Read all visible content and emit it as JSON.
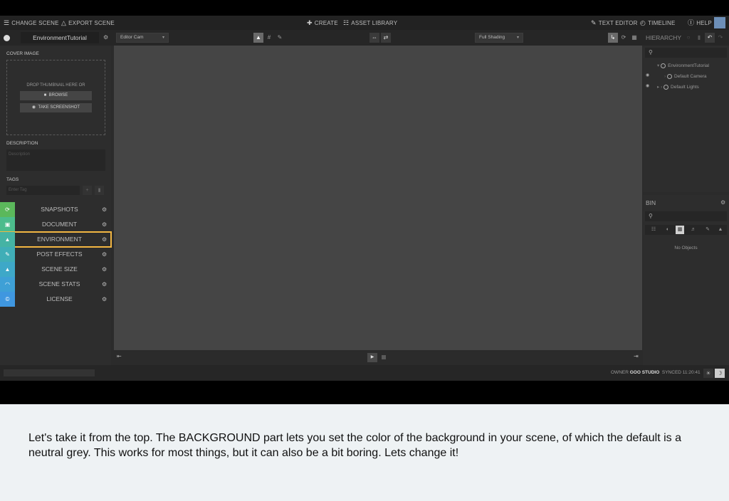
{
  "menubar": {
    "change_scene": "CHANGE SCENE",
    "export_scene": "EXPORT SCENE",
    "create": "CREATE",
    "asset_library": "ASSET LIBRARY",
    "text_editor": "TEXT EDITOR",
    "timeline": "TIMELINE",
    "help": "HELP"
  },
  "toolbar": {
    "scene_name": "EnvironmentTutorial",
    "camera_select": "Editor Cam",
    "shading_select": "Full Shading",
    "hierarchy_label": "HIERARCHY"
  },
  "left_panel": {
    "cover_image_label": "COVER IMAGE",
    "drop_text": "DROP THUMBNAIL HERE OR",
    "browse_label": "BROWSE",
    "screenshot_label": "TAKE SCREENSHOT",
    "description_label": "DESCRIPTION",
    "description_placeholder": "Description",
    "tags_label": "TAGS",
    "tag_placeholder": "Enter Tag",
    "sections": [
      {
        "label": "SNAPSHOTS",
        "color": "#5bb85b",
        "icon": "history-icon"
      },
      {
        "label": "DOCUMENT",
        "color": "#4cbc8c",
        "icon": "document-icon"
      },
      {
        "label": "ENVIRONMENT",
        "color": "#45b3a4",
        "icon": "landscape-icon"
      },
      {
        "label": "POST EFFECTS",
        "color": "#40aeb7",
        "icon": "wand-icon"
      },
      {
        "label": "SCENE SIZE",
        "color": "#3ea8c8",
        "icon": "weight-icon"
      },
      {
        "label": "SCENE STATS",
        "color": "#3ea0d6",
        "icon": "gauge-icon"
      },
      {
        "label": "LICENSE",
        "color": "#3f97e0",
        "icon": "copyright-icon"
      }
    ]
  },
  "hierarchy": {
    "items": [
      "EnvironmentTutorial",
      "Default Camera",
      "Default Lights"
    ]
  },
  "bin": {
    "title": "BIN",
    "empty_text": "No Objects"
  },
  "status": {
    "owner_label": "OWNER",
    "owner_name": "GOO STUDIO",
    "synced": "SYNCED 11:20:41"
  },
  "caption": "Let's take it from the top. The BACKGROUND part lets you set the color of the background in your scene, of which the default is a neutral grey. This works for most things, but it can also be a bit boring. Lets change it!",
  "colors": {
    "highlight": "#f2b642",
    "viewport": "#454545"
  }
}
